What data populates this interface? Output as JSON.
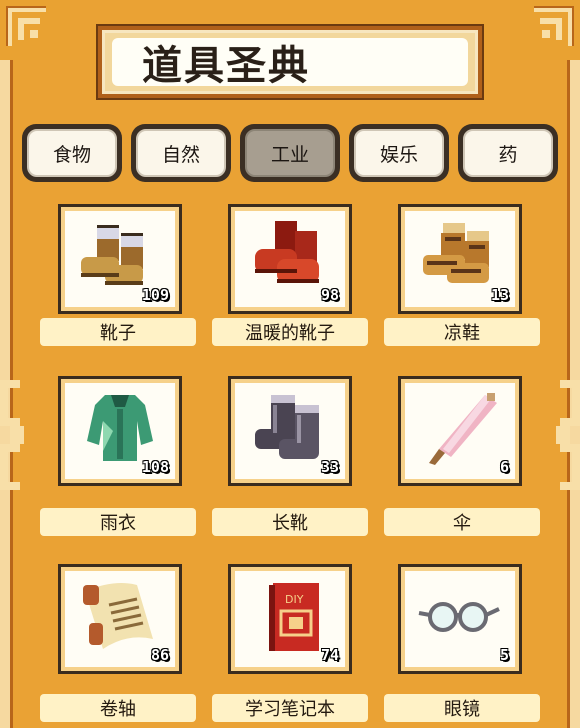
{
  "title": "道具圣典",
  "tabs": [
    {
      "label": "食物",
      "active": false
    },
    {
      "label": "自然",
      "active": false
    },
    {
      "label": "工业",
      "active": true
    },
    {
      "label": "娱乐",
      "active": false
    },
    {
      "label": "药",
      "active": false
    }
  ],
  "items": [
    {
      "name": "靴子",
      "count": "109",
      "icon": "boots-icon"
    },
    {
      "name": "温暖的靴子",
      "count": "98",
      "icon": "warm-boots-icon"
    },
    {
      "name": "凉鞋",
      "count": "13",
      "icon": "sandals-icon"
    },
    {
      "name": "雨衣",
      "count": "108",
      "icon": "raincoat-icon"
    },
    {
      "name": "长靴",
      "count": "33",
      "icon": "rain-boots-icon"
    },
    {
      "name": "伞",
      "count": "6",
      "icon": "umbrella-icon"
    },
    {
      "name": "卷轴",
      "count": "86",
      "icon": "scroll-icon"
    },
    {
      "name": "学习笔记本",
      "count": "74",
      "icon": "study-notebook-icon"
    },
    {
      "name": "眼镜",
      "count": "5",
      "icon": "glasses-icon"
    }
  ],
  "notebook_cover_text": "DIY",
  "colors": {
    "background": "#eaa234",
    "tab_active": "#a79e90",
    "label_bg": "#fff2c6"
  }
}
